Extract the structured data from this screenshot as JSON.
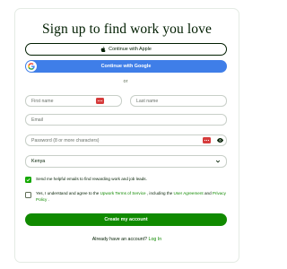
{
  "title": "Sign up to find work you love",
  "buttons": {
    "apple_label": "Continue with Apple",
    "google_label": "Continue with Google",
    "create_label": "Create my account"
  },
  "divider": "or",
  "fields": {
    "first_name_placeholder": "First name",
    "last_name_placeholder": "Last name",
    "email_placeholder": "Email",
    "password_placeholder": "Password (8 or more characters)",
    "country_value": "Kenya"
  },
  "checkboxes": {
    "emails_text": "Send me helpful emails to find rewarding work and job leads.",
    "emails_checked": true,
    "terms_prefix": "Yes, I understand and agree to the ",
    "terms_link": "Upwork Terms of Service",
    "terms_middle": " , including the ",
    "user_agreement_link": "User Agreement",
    "terms_and": " and ",
    "privacy_link": "Privacy Policy",
    "terms_suffix": " .",
    "terms_checked": false
  },
  "footer": {
    "prompt": "Already have an account?",
    "login_link": "Log In"
  },
  "colors": {
    "brand_green": "#108a00",
    "google_blue": "#3f7ee8",
    "text": "#001e00"
  },
  "icons": [
    "apple-icon",
    "google-icon",
    "password-manager-icon",
    "eye-icon",
    "chevron-down-icon",
    "check-icon"
  ]
}
